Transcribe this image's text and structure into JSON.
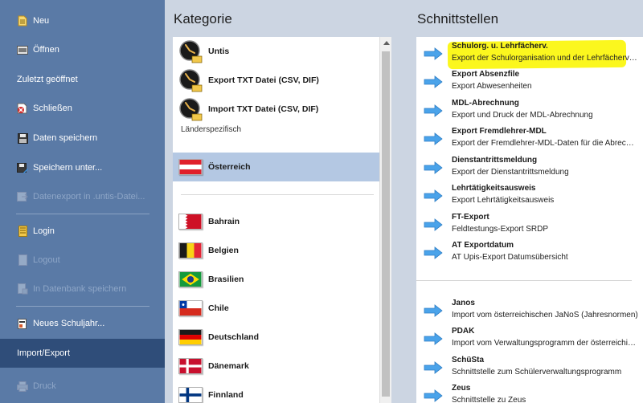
{
  "menu": {
    "items": [
      {
        "label": "Neu",
        "icon": "new-document-icon",
        "disabled": false
      },
      {
        "label": "Öffnen",
        "icon": "open-icon",
        "disabled": false
      },
      {
        "label": "Zuletzt geöffnet",
        "icon": "",
        "disabled": false
      },
      {
        "label": "Schließen",
        "icon": "close-file-icon",
        "disabled": false
      },
      {
        "label": "Daten speichern",
        "icon": "save-icon",
        "disabled": false
      },
      {
        "label": "Speichern unter...",
        "icon": "save-as-icon",
        "disabled": false
      },
      {
        "label": "Datenexport in .untis-Datei...",
        "icon": "export-file-icon",
        "disabled": true
      },
      {
        "label": "Login",
        "icon": "login-icon",
        "disabled": false
      },
      {
        "label": "Logout",
        "icon": "logout-icon",
        "disabled": true
      },
      {
        "label": "In Datenbank speichern",
        "icon": "database-save-icon",
        "disabled": true
      },
      {
        "label": "Neues Schuljahr...",
        "icon": "new-school-year-icon",
        "disabled": false
      },
      {
        "label": "Import/Export",
        "icon": "",
        "disabled": false,
        "active": true
      },
      {
        "label": "Druck",
        "icon": "print-icon",
        "disabled": true
      }
    ]
  },
  "kategorie": {
    "heading": "Kategorie",
    "top_items": [
      {
        "label": "Untis"
      },
      {
        "label": "Export TXT Datei (CSV, DIF)"
      },
      {
        "label": "Import TXT Datei (CSV, DIF)"
      }
    ],
    "section_label": "Länderspezifisch",
    "selected": {
      "label": "Österreich"
    },
    "countries": [
      {
        "label": "Bahrain"
      },
      {
        "label": "Belgien"
      },
      {
        "label": "Brasilien"
      },
      {
        "label": "Chile"
      },
      {
        "label": "Deutschland"
      },
      {
        "label": "Dänemark"
      },
      {
        "label": "Finnland"
      }
    ]
  },
  "schnittstellen": {
    "heading": "Schnittstellen",
    "export_items": [
      {
        "title": "Schulorg. u. Lehrfächerv.",
        "desc": "Export der Schulorganisation und der Lehrfächerverteilung",
        "highlighted": true
      },
      {
        "title": "Export Absenzfile",
        "desc": "Export Abwesenheiten"
      },
      {
        "title": "MDL-Abrechnung",
        "desc": "Export und Druck der MDL-Abrechnung"
      },
      {
        "title": "Export Fremdlehrer-MDL",
        "desc": "Export der Fremdlehrer-MDL-Daten für die Abrechnung"
      },
      {
        "title": "Dienstantrittsmeldung",
        "desc": "Export der Dienstantrittsmeldung"
      },
      {
        "title": "Lehrtätigkeitsausweis",
        "desc": "Export Lehrtätigkeitsausweis"
      },
      {
        "title": "FT-Export",
        "desc": "Feldtestungs-Export SRDP"
      },
      {
        "title": "AT Exportdatum",
        "desc": "AT Upis-Export Datumsübersicht"
      }
    ],
    "import_items": [
      {
        "title": "Janos",
        "desc": "Import vom österreichischen JaNoS (Jahresnormen)"
      },
      {
        "title": "PDAK",
        "desc": "Import vom Verwaltungsprogramm der österreichischen Schulen"
      },
      {
        "title": "SchüSta",
        "desc": "Schnittstelle zum Schülerverwaltungsprogramm"
      },
      {
        "title": "Zeus",
        "desc": "Schnittstelle zu Zeus"
      }
    ]
  },
  "colors": {
    "sidebar": "#5a7aa6",
    "sidebar_active": "#2f4d79",
    "background": "#ccd5e2",
    "selection": "#b4c8e3",
    "highlight": "#fbf71e",
    "arrow": "#3d8fdb"
  }
}
